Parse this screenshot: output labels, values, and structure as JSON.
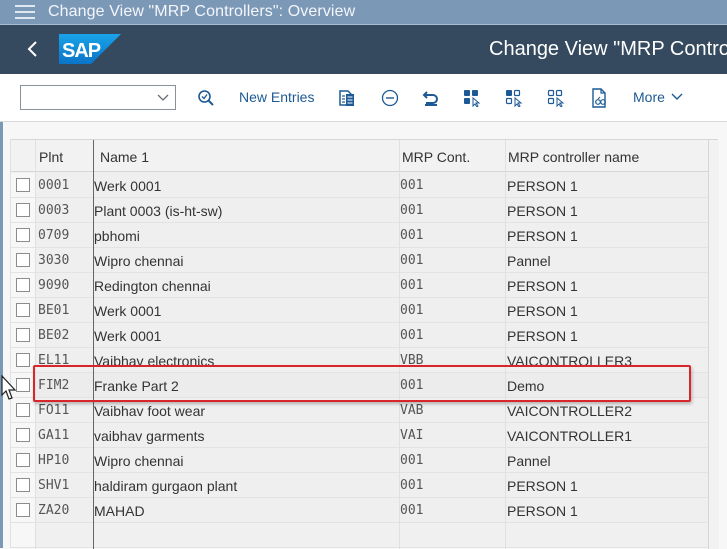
{
  "window": {
    "title": "Change View \"MRP Controllers\": Overview"
  },
  "shell": {
    "app_title": "Change View \"MRP Controllers\": Overview",
    "logo_text": "SAP",
    "brand_color": "#0a6ed1"
  },
  "toolbar": {
    "combo_value": "",
    "new_entries_label": "New Entries",
    "more_label": "More",
    "icons": [
      "display-check-icon",
      "copy-as-icon",
      "delete-icon",
      "undo-icon",
      "select-all-icon",
      "select-block-icon",
      "deselect-all-icon",
      "print-preview-icon"
    ]
  },
  "table": {
    "columns": [
      "Plnt",
      "Name 1",
      "MRP Cont.",
      "MRP controller name"
    ],
    "rows": [
      {
        "plnt": "0001",
        "name": "Werk 0001",
        "mrp": "001",
        "controller": "PERSON 1"
      },
      {
        "plnt": "0003",
        "name": "Plant 0003 (is-ht-sw)",
        "mrp": "001",
        "controller": "PERSON 1"
      },
      {
        "plnt": "0709",
        "name": "pbhomi",
        "mrp": "001",
        "controller": "PERSON 1"
      },
      {
        "plnt": "3030",
        "name": "Wipro chennai",
        "mrp": "001",
        "controller": "Pannel"
      },
      {
        "plnt": "9090",
        "name": "Redington chennai",
        "mrp": "001",
        "controller": "PERSON 1"
      },
      {
        "plnt": "BE01",
        "name": "Werk 0001",
        "mrp": "001",
        "controller": "PERSON 1"
      },
      {
        "plnt": "BE02",
        "name": "Werk 0001",
        "mrp": "001",
        "controller": "PERSON 1"
      },
      {
        "plnt": "EL11",
        "name": "Vaibhav electronics",
        "mrp": "VBB",
        "controller": "VAICONTROLLER3"
      },
      {
        "plnt": "FIM2",
        "name": "Franke Part 2",
        "mrp": "001",
        "controller": "Demo"
      },
      {
        "plnt": "FO11",
        "name": "Vaibhav foot wear",
        "mrp": "VAB",
        "controller": "VAICONTROLLER2"
      },
      {
        "plnt": "GA11",
        "name": "vaibhav garments",
        "mrp": "VAI",
        "controller": "VAICONTROLLER1"
      },
      {
        "plnt": "HP10",
        "name": "Wipro chennai",
        "mrp": "001",
        "controller": "Pannel"
      },
      {
        "plnt": "SHV1",
        "name": "haldiram gurgaon plant",
        "mrp": "001",
        "controller": "PERSON 1"
      },
      {
        "plnt": "ZA20",
        "name": "MAHAD",
        "mrp": "001",
        "controller": "PERSON 1"
      }
    ],
    "highlighted_row": 8,
    "highlight_color": "#d9262c"
  }
}
